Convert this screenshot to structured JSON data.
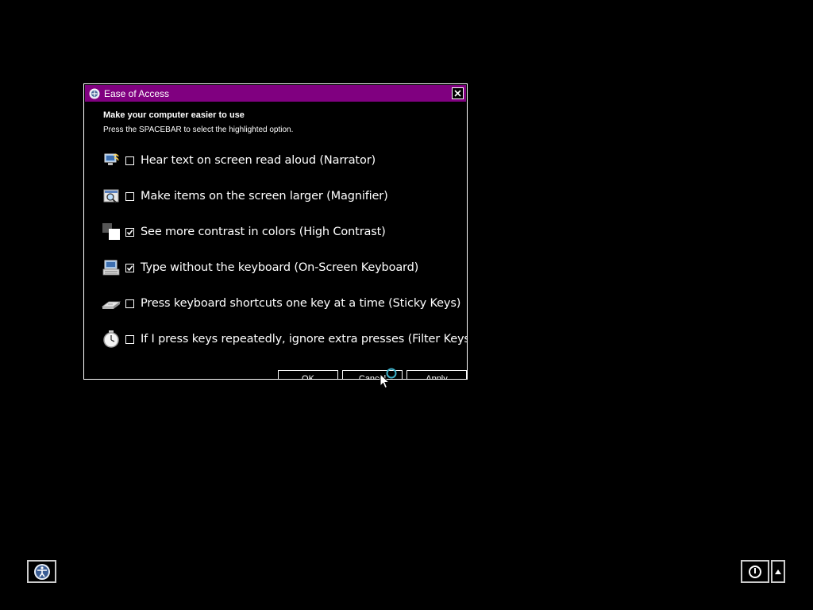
{
  "dialog": {
    "title": "Ease of Access",
    "title_icon": "ease-of-access-icon",
    "close_icon": "close-icon",
    "heading": "Make your computer easier to use",
    "subheading": "Press the SPACEBAR to select the highlighted option.",
    "options": [
      {
        "label": "Hear text on screen read aloud (Narrator)",
        "checked": false,
        "icon": "narrator-icon"
      },
      {
        "label": "Make items on the screen larger (Magnifier)",
        "checked": false,
        "icon": "magnifier-icon"
      },
      {
        "label": "See more contrast in colors (High Contrast)",
        "checked": true,
        "icon": "high-contrast-icon"
      },
      {
        "label": "Type without the keyboard (On-Screen Keyboard)",
        "checked": true,
        "icon": "on-screen-keyboard-icon"
      },
      {
        "label": "Press keyboard shortcuts one key at a time (Sticky Keys)",
        "checked": false,
        "icon": "sticky-keys-icon"
      },
      {
        "label": "If I press keys repeatedly, ignore extra presses (Filter Keys)",
        "checked": false,
        "icon": "filter-keys-icon"
      }
    ],
    "buttons": {
      "ok": "OK",
      "cancel": "Cancel",
      "apply": "Apply"
    }
  },
  "desktop": {
    "ease_of_access_button_icon": "ease-of-access-icon",
    "power_button_icon": "power-icon",
    "power_options_icon": "arrow-up-icon"
  },
  "colors": {
    "titlebar": "#800080",
    "background": "#000000",
    "foreground": "#ffffff"
  }
}
